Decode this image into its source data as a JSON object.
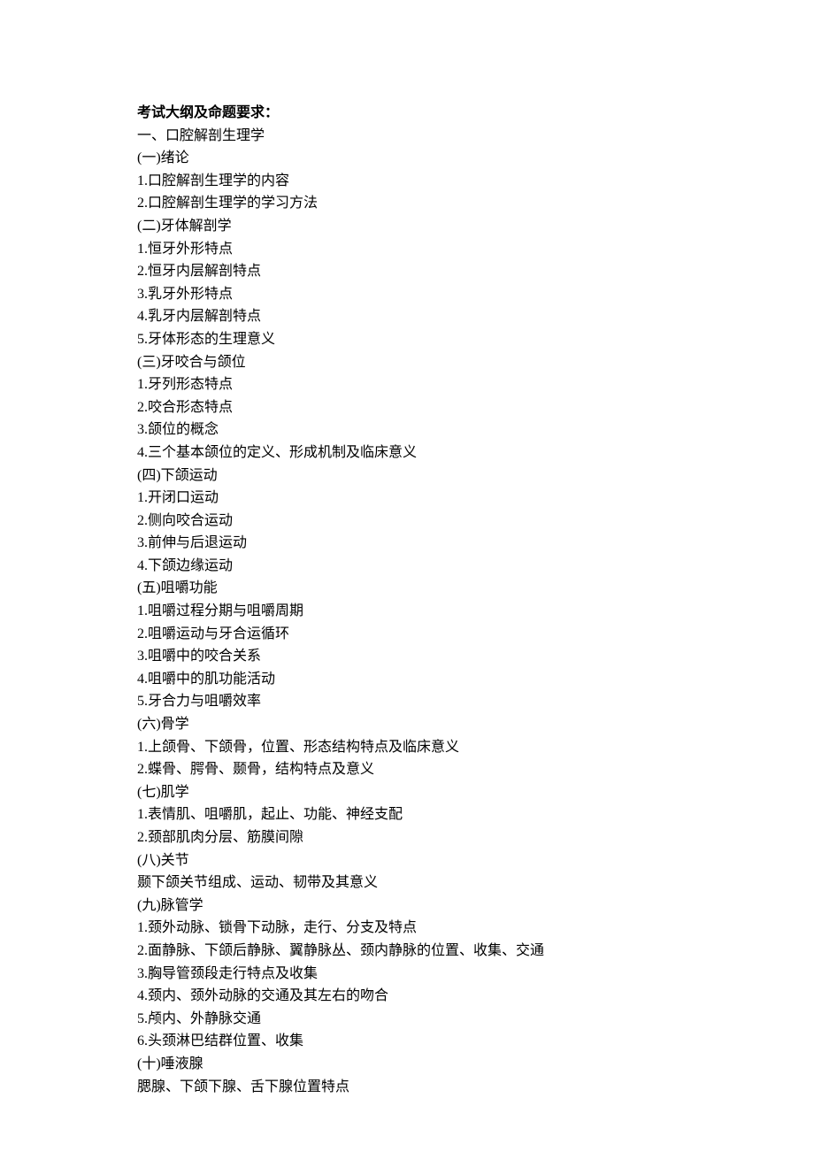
{
  "title": "考试大纲及命题要求：",
  "lines": [
    "一、口腔解剖生理学",
    "(一)绪论",
    "1.口腔解剖生理学的内容",
    "2.口腔解剖生理学的学习方法",
    "(二)牙体解剖学",
    "1.恒牙外形特点",
    "2.恒牙内层解剖特点",
    "3.乳牙外形特点",
    "4.乳牙内层解剖特点",
    "5.牙体形态的生理意义",
    "(三)牙咬合与颌位",
    "1.牙列形态特点",
    "2.咬合形态特点",
    "3.颌位的概念",
    "4.三个基本颌位的定义、形成机制及临床意义",
    "(四)下颌运动",
    "1.开闭口运动",
    "2.侧向咬合运动",
    "3.前伸与后退运动",
    "4.下颌边缘运动",
    "(五)咀嚼功能",
    "1.咀嚼过程分期与咀嚼周期",
    "2.咀嚼运动与牙合运循环",
    "3.咀嚼中的咬合关系",
    "4.咀嚼中的肌功能活动",
    "5.牙合力与咀嚼效率",
    "(六)骨学",
    "1.上颌骨、下颌骨，位置、形态结构特点及临床意义",
    "2.蝶骨、腭骨、颞骨，结构特点及意义",
    "(七)肌学",
    "1.表情肌、咀嚼肌，起止、功能、神经支配",
    "2.颈部肌肉分层、筋膜间隙",
    "(八)关节",
    "颞下颌关节组成、运动、韧带及其意义",
    "(九)脉管学",
    "1.颈外动脉、锁骨下动脉，走行、分支及特点",
    "2.面静脉、下颌后静脉、翼静脉丛、颈内静脉的位置、收集、交通",
    "3.胸导管颈段走行特点及收集",
    "4.颈内、颈外动脉的交通及其左右的吻合",
    "5.颅内、外静脉交通",
    "6.头颈淋巴结群位置、收集",
    "(十)唾液腺",
    "腮腺、下颌下腺、舌下腺位置特点"
  ]
}
